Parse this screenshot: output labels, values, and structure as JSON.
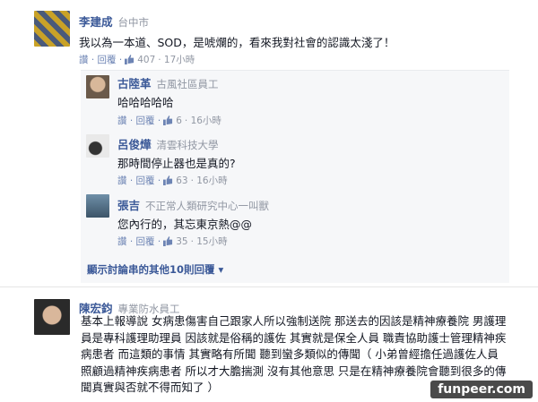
{
  "comments": [
    {
      "name": "李建成",
      "affiliation": "台中市",
      "text": "我以為一本道、SOD，是唬爛的，看來我對社會的認識太淺了！",
      "actions": "讚 · 回覆 ·",
      "likes": "407",
      "time": "· 17小時"
    },
    {
      "name": "古陸革",
      "affiliation": "古風社區員工",
      "text": "哈哈哈哈哈",
      "actions": "讚 · 回覆 ·",
      "likes": "6",
      "time": "· 16小時"
    },
    {
      "name": "呂俊燁",
      "affiliation": "清雲科技大學",
      "text": "那時間停止器也是真的?",
      "actions": "讚 · 回覆 ·",
      "likes": "63",
      "time": "· 16小時"
    },
    {
      "name": "張吉",
      "affiliation": "不正常人類研究中心一叫獸",
      "text": "您內行的，其忘東京熱@@",
      "actions": "讚 · 回覆 ·",
      "likes": "35",
      "time": "· 15小時"
    }
  ],
  "more_replies": "顯示討論串的其他10則回覆 ▾",
  "last_comment": {
    "name": "陳宏鈞",
    "affiliation": "專業防水員工",
    "text": "基本上報導說 女病患傷害自己跟家人所以強制送院 那送去的因該是精神療養院 男護理員是專科護理助理員 因該就是俗稱的護佐 其實就是保全人員 職責協助護士管理精神疾病患者 而這類的事情 其實略有所聞 聽到蠻多類似的傳聞（ 小弟曾經擔任過護佐人員 照顧過精神疾病患者 所以才大膽揣測 沒有其他意思 只是在精神療養院會聽到很多的傳聞真實與否就不得而知了 ）"
  },
  "watermark": "funpeer.com",
  "colors": {
    "name": "#3b5998",
    "meta": "#9197a3",
    "like": "#6d84b4",
    "reply_bg": "#f6f7f9"
  }
}
